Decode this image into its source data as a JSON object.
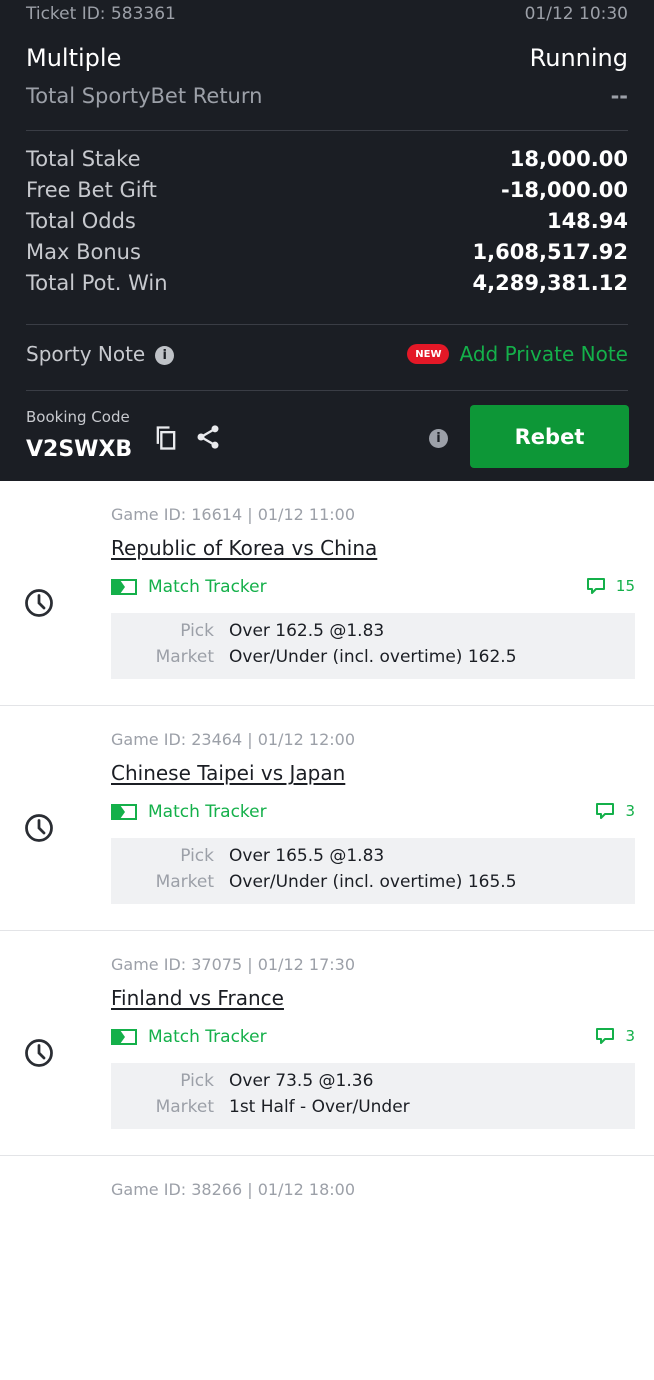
{
  "ticket": {
    "id_label": "Ticket ID: 583361",
    "datetime": "01/12 10:30",
    "bet_type": "Multiple",
    "status": "Running",
    "return_label": "Total SportyBet Return",
    "return_value": "--"
  },
  "summary": [
    {
      "label": "Total Stake",
      "value": "18,000.00"
    },
    {
      "label": "Free Bet Gift",
      "value": "-18,000.00"
    },
    {
      "label": "Total Odds",
      "value": "148.94"
    },
    {
      "label": "Max Bonus",
      "value": "1,608,517.92"
    },
    {
      "label": "Total Pot. Win",
      "value": "4,289,381.12"
    }
  ],
  "note": {
    "label": "Sporty Note",
    "new_badge": "NEW",
    "add_label": "Add Private Note"
  },
  "booking": {
    "label": "Booking Code",
    "code": "V2SWXB",
    "rebet_label": "Rebet"
  },
  "games": [
    {
      "id_line": "Game ID: 16614 | 01/12 11:00",
      "name": "Republic of Korea vs China",
      "tracker": "Match Tracker",
      "comments": "15",
      "pick_label": "Pick",
      "pick": "Over 162.5 @1.83",
      "market_label": "Market",
      "market": "Over/Under (incl. overtime) 162.5"
    },
    {
      "id_line": "Game ID: 23464 | 01/12 12:00",
      "name": "Chinese Taipei vs Japan",
      "tracker": "Match Tracker",
      "comments": "3",
      "pick_label": "Pick",
      "pick": "Over 165.5 @1.83",
      "market_label": "Market",
      "market": "Over/Under (incl. overtime) 165.5"
    },
    {
      "id_line": "Game ID: 37075 | 01/12 17:30",
      "name": "Finland vs France",
      "tracker": "Match Tracker",
      "comments": "3",
      "pick_label": "Pick",
      "pick": "Over 73.5 @1.36",
      "market_label": "Market",
      "market": "1st Half - Over/Under"
    },
    {
      "id_line": "Game ID: 38266 | 01/12 18:00"
    }
  ],
  "colors": {
    "header_bg": "#1b1e24",
    "accent_green": "#14b04a",
    "rebet_green": "#0d9737",
    "new_red": "#e41827"
  }
}
